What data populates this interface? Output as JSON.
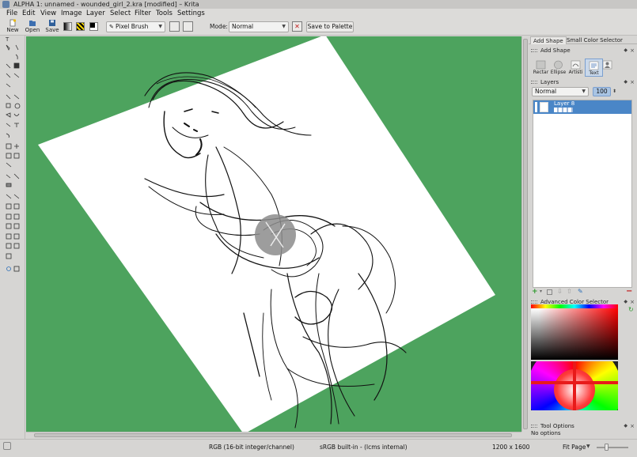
{
  "window": {
    "title": "ALPHA 1: unnamed - wounded_girl_2.kra [modified] – Krita"
  },
  "menubar": {
    "items": [
      "File",
      "Edit",
      "View",
      "Image",
      "Layer",
      "Select",
      "Filter",
      "Tools",
      "Settings"
    ]
  },
  "toolbar": {
    "new_label": "New",
    "open_label": "Open",
    "save_label": "Save",
    "brush_preset": "Pixel Brush",
    "mode_label": "Mode:",
    "blend_mode": "Normal",
    "save_palette_label": "Save to Palette"
  },
  "right_panel": {
    "tabs": [
      "Add Shape",
      "Small Color Selector"
    ],
    "add_shape": {
      "title": "Add Shape",
      "shapes": [
        "Rectar",
        "Ellipse",
        "Artisti",
        "Text"
      ]
    },
    "layers": {
      "title": "Layers",
      "blend_mode": "Normal",
      "opacity": "100",
      "items": [
        {
          "name": "Layer 8"
        }
      ]
    },
    "color_selector": {
      "title": "Advanced Color Selector"
    },
    "tool_options": {
      "title": "Tool Options",
      "text": "No options"
    }
  },
  "status": {
    "color_model": "RGB (16-bit integer/channel)",
    "profile": "sRGB built-in - (lcms internal)",
    "image_size": "1200 x 1600",
    "zoom": "Fit Page"
  },
  "colors": {
    "canvas_background": "#4da35e",
    "selection_highlight": "#4a86c7"
  }
}
